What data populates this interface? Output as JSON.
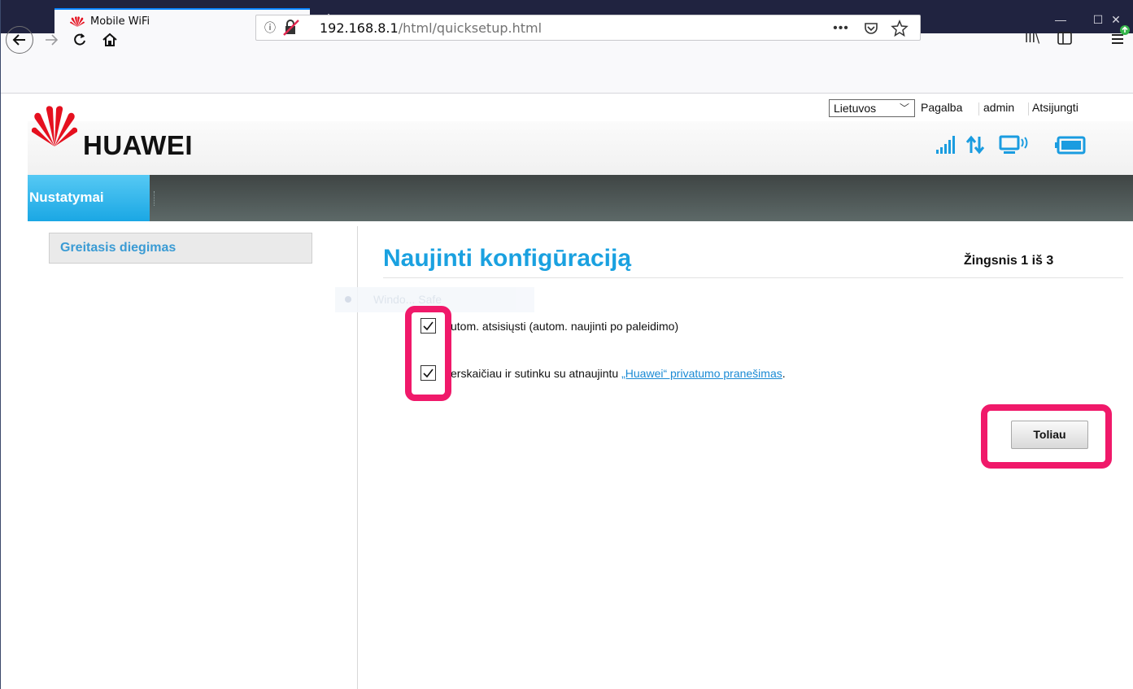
{
  "browser": {
    "tab_title": "Mobile WiFi",
    "tab_close": "×",
    "new_tab": "+",
    "url_host": "192.168.8.1",
    "url_path": "/html/quicksetup.html",
    "url_more": "•••",
    "window_min": "—",
    "window_max": "☐",
    "window_close": "✕",
    "info_icon": "ⓘ",
    "library_icon": "III\\"
  },
  "top_links": {
    "language": "Lietuvos",
    "help": "Pagalba",
    "user": "admin",
    "logout": "Atsijungti"
  },
  "brand": {
    "name": "HUAWEI",
    "logo_color": "#e5101f"
  },
  "menu": {
    "active_tab": "Nustatymai"
  },
  "sidebar": {
    "items": [
      {
        "label": "Greitasis diegimas"
      }
    ]
  },
  "content": {
    "title": "Naujinti konfigūraciją",
    "step": "Žingsnis 1 iš 3",
    "ghost_text": "Windo... Safe",
    "options": [
      {
        "label": "utom. atsisiųsti (autom. naujinti po paleidimo)",
        "checked": true
      },
      {
        "label_prefix": "erskaičiau ir sutinku su atnaujintu ",
        "link": "„Huawei“ privatumo pranešimas",
        "label_suffix": ".",
        "checked": true
      }
    ],
    "next_button": "Toliau"
  },
  "colors": {
    "accent_blue": "#1aa1e0",
    "highlight": "#f0196a",
    "menu_dark": "#4a5352",
    "status_icon": "#1a9ce0"
  }
}
